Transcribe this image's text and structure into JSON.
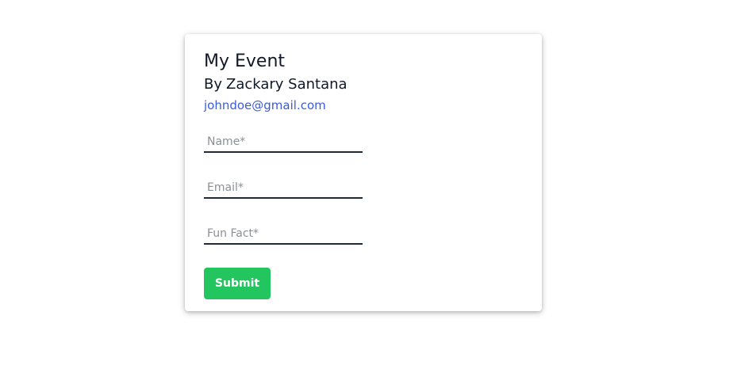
{
  "event": {
    "title": "My Event",
    "author_prefix": "By",
    "author_name": "Zackary Santana",
    "contact_email": "johndoe@gmail.com"
  },
  "form": {
    "name_placeholder": "Name*",
    "email_placeholder": "Email*",
    "fun_fact_placeholder": "Fun Fact*",
    "submit_label": "Submit"
  },
  "colors": {
    "accent_button": "#22c55e",
    "link": "#3b5bdb",
    "underline": "#1f2937"
  }
}
